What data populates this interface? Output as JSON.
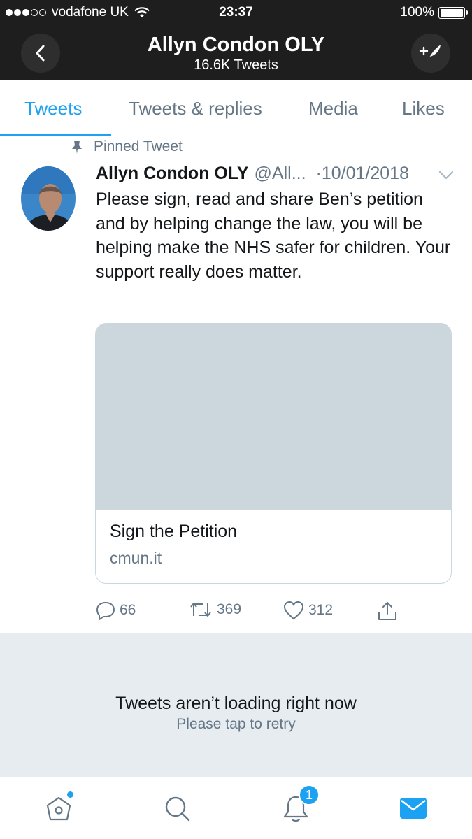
{
  "status_bar": {
    "carrier": "vodafone UK",
    "time": "23:37",
    "battery": "100%",
    "signal_icon": "signal-dots-icon",
    "wifi_icon": "wifi-icon"
  },
  "header": {
    "title": "Allyn Condon OLY",
    "subtitle": "16.6K Tweets",
    "back_icon": "chevron-left-icon",
    "compose_icon": "compose-tweet-icon"
  },
  "tabs": [
    {
      "label": "Tweets",
      "active": true
    },
    {
      "label": "Tweets & replies",
      "active": false
    },
    {
      "label": "Media",
      "active": false
    },
    {
      "label": "Likes",
      "active": false
    }
  ],
  "tweet": {
    "pinned_label": "Pinned Tweet",
    "author_name": "Allyn Condon OLY",
    "author_handle": "@All...",
    "date": "·10/01/2018",
    "text": "Please sign, read and share Ben’s petition and by helping change the law, you will be helping make the NHS safer for children. Your support really does matter.",
    "card": {
      "title": "Sign the Petition",
      "domain": "cmun.it"
    },
    "actions": {
      "replies": "66",
      "retweets": "369",
      "likes": "312"
    }
  },
  "error": {
    "title": "Tweets aren’t loading right now",
    "subtitle": "Please tap to retry"
  },
  "bottom_nav": {
    "items": [
      "home-icon",
      "search-icon",
      "notifications-icon",
      "messages-icon"
    ],
    "notification_count": "1",
    "accent": "#1da1f2"
  },
  "colors": {
    "accent": "#1da1f2",
    "secondary_text": "#657786",
    "primary_text": "#14171a",
    "header_bg": "#1e1e1e"
  }
}
